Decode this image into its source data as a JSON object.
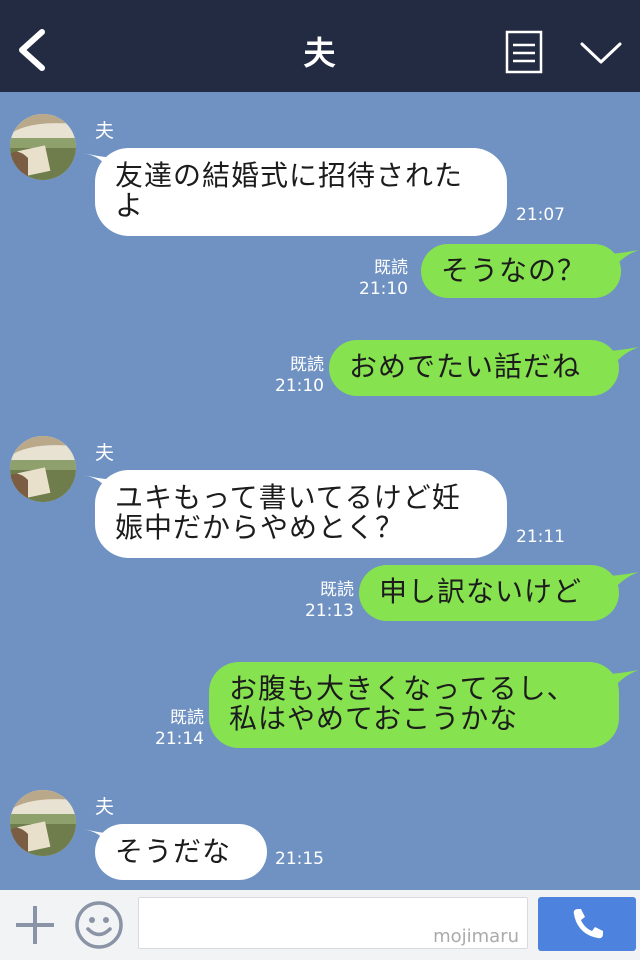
{
  "header": {
    "title": "夫"
  },
  "messages": [
    {
      "side": "in",
      "sender": "夫",
      "text": "友達の結婚式に招待されたよ",
      "line1": "友達の結婚式に招待された",
      "line2": "よ",
      "time": "21:07"
    },
    {
      "side": "out",
      "text": "そうなの？",
      "read": "既読",
      "time": "21:10"
    },
    {
      "side": "out",
      "text": "おめでたい話だね",
      "read": "既読",
      "time": "21:10"
    },
    {
      "side": "in",
      "sender": "夫",
      "text": "ユキもって書いてるけど妊娠中だからやめとく？",
      "line1": "ユキもって書いてるけど妊",
      "line2": "娠中だからやめとく？",
      "time": "21:11"
    },
    {
      "side": "out",
      "text": "申し訳ないけど",
      "read": "既読",
      "time": "21:13"
    },
    {
      "side": "out",
      "text": "お腹も大きくなってるし、私はやめておこうかな",
      "line1": "お腹も大きくなってるし、",
      "line2": "私はやめておこうかな",
      "read": "既読",
      "time": "21:14"
    },
    {
      "side": "in",
      "sender": "夫",
      "text": "そうだな",
      "time": "21:15"
    }
  ],
  "footer": {
    "input_text": "mojimaru"
  },
  "icons": {
    "back": "chevron-left-icon",
    "menu": "menu-list-icon",
    "collapse": "chevron-down-icon",
    "plus": "plus-icon",
    "emoji": "smiley-icon",
    "call": "phone-icon",
    "avatar": "avatar-image"
  },
  "colors": {
    "header": "#232b43",
    "chat_background": "#7092c3",
    "incoming_bubble": "#ffffff",
    "outgoing_bubble": "#86e24f",
    "call_button": "#4e82df"
  }
}
